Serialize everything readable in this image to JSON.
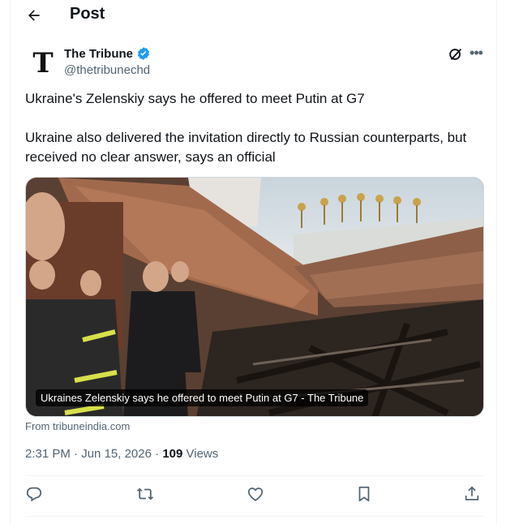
{
  "header": {
    "title": "Post",
    "back_icon": "arrow-left-icon"
  },
  "author": {
    "name": "The Tribune",
    "handle": "@thetribunechd",
    "avatar_letter": "T",
    "verified_color": "#1d9bf0"
  },
  "post": {
    "headline": "Ukraine's Zelenskiy says he offered to meet Putin at G7",
    "body": "Ukraine also delivered the invitation directly to Russian counterparts, but received no clear answer, says an official"
  },
  "card": {
    "caption": "Ukraines Zelenskiy says he offered to meet Putin at G7 - The Tribune",
    "source": "From tribuneindia.com"
  },
  "meta": {
    "time": "2:31 PM",
    "date": "Jun 15, 2026",
    "views_count": "109",
    "views_label": "Views"
  },
  "actions": [
    "reply-icon",
    "repost-icon",
    "like-icon",
    "bookmark-icon",
    "share-icon"
  ],
  "colors": {
    "text": "#0f1419",
    "muted": "#536471",
    "accent": "#1d9bf0",
    "border": "#eff3f4"
  }
}
